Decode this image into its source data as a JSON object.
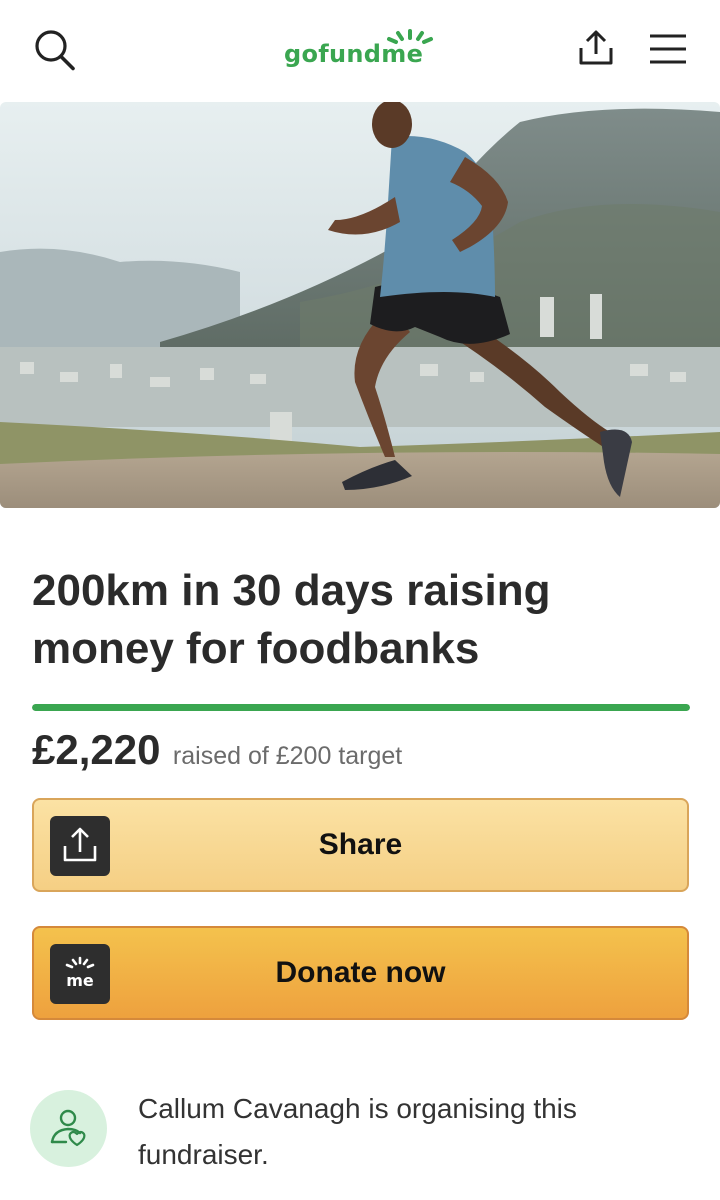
{
  "header": {
    "logo_text": "gofundme",
    "search_icon": "search-icon",
    "share_icon": "share-upload-icon",
    "menu_icon": "hamburger-menu-icon"
  },
  "hero": {
    "image": "runner-on-mountain-road-photo"
  },
  "campaign": {
    "title": "200km in 30 days raising money for foodbanks",
    "raised_amount": "£2,220",
    "raised_text": "raised of £200 target",
    "progress_fraction": 1.0
  },
  "actions": {
    "share_label": "Share",
    "donate_label": "Donate now"
  },
  "organiser": {
    "text": "Callum Cavanagh is organising this fundraiser.",
    "icon": "person-heart-icon"
  },
  "colors": {
    "brand_green": "#3aa650",
    "share_button": "#f8d896",
    "donate_button": "#f0b043",
    "avatar_bg": "#d8f1de"
  }
}
